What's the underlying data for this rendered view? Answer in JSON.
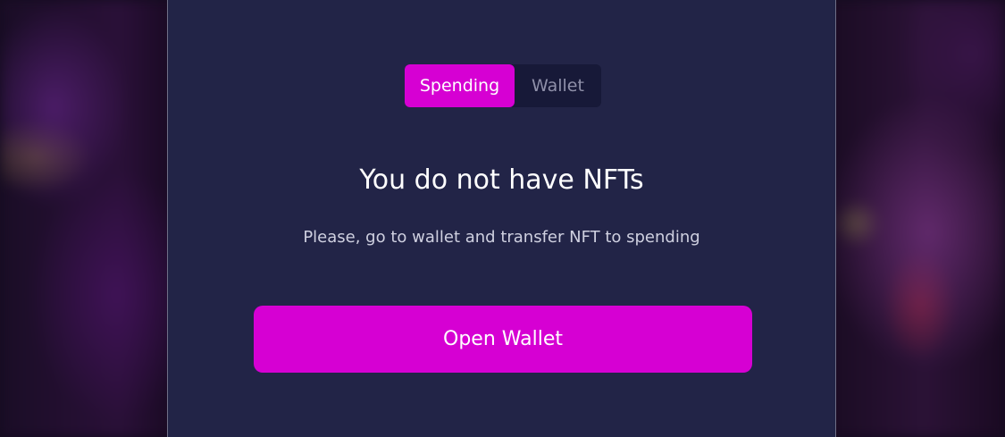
{
  "tabs": {
    "items": [
      {
        "label": "Spending",
        "active": true
      },
      {
        "label": "Wallet",
        "active": false
      }
    ]
  },
  "empty_state": {
    "title": "You do not have NFTs",
    "message": "Please, go to wallet and transfer NFT to spending",
    "action_label": "Open Wallet"
  },
  "colors": {
    "accent": "#d600d3",
    "panel_bg": "#222447",
    "tabs_bg": "#171938",
    "text_primary": "#ffffff",
    "text_secondary": "#cfd0e0",
    "text_muted": "#8f90a9"
  }
}
